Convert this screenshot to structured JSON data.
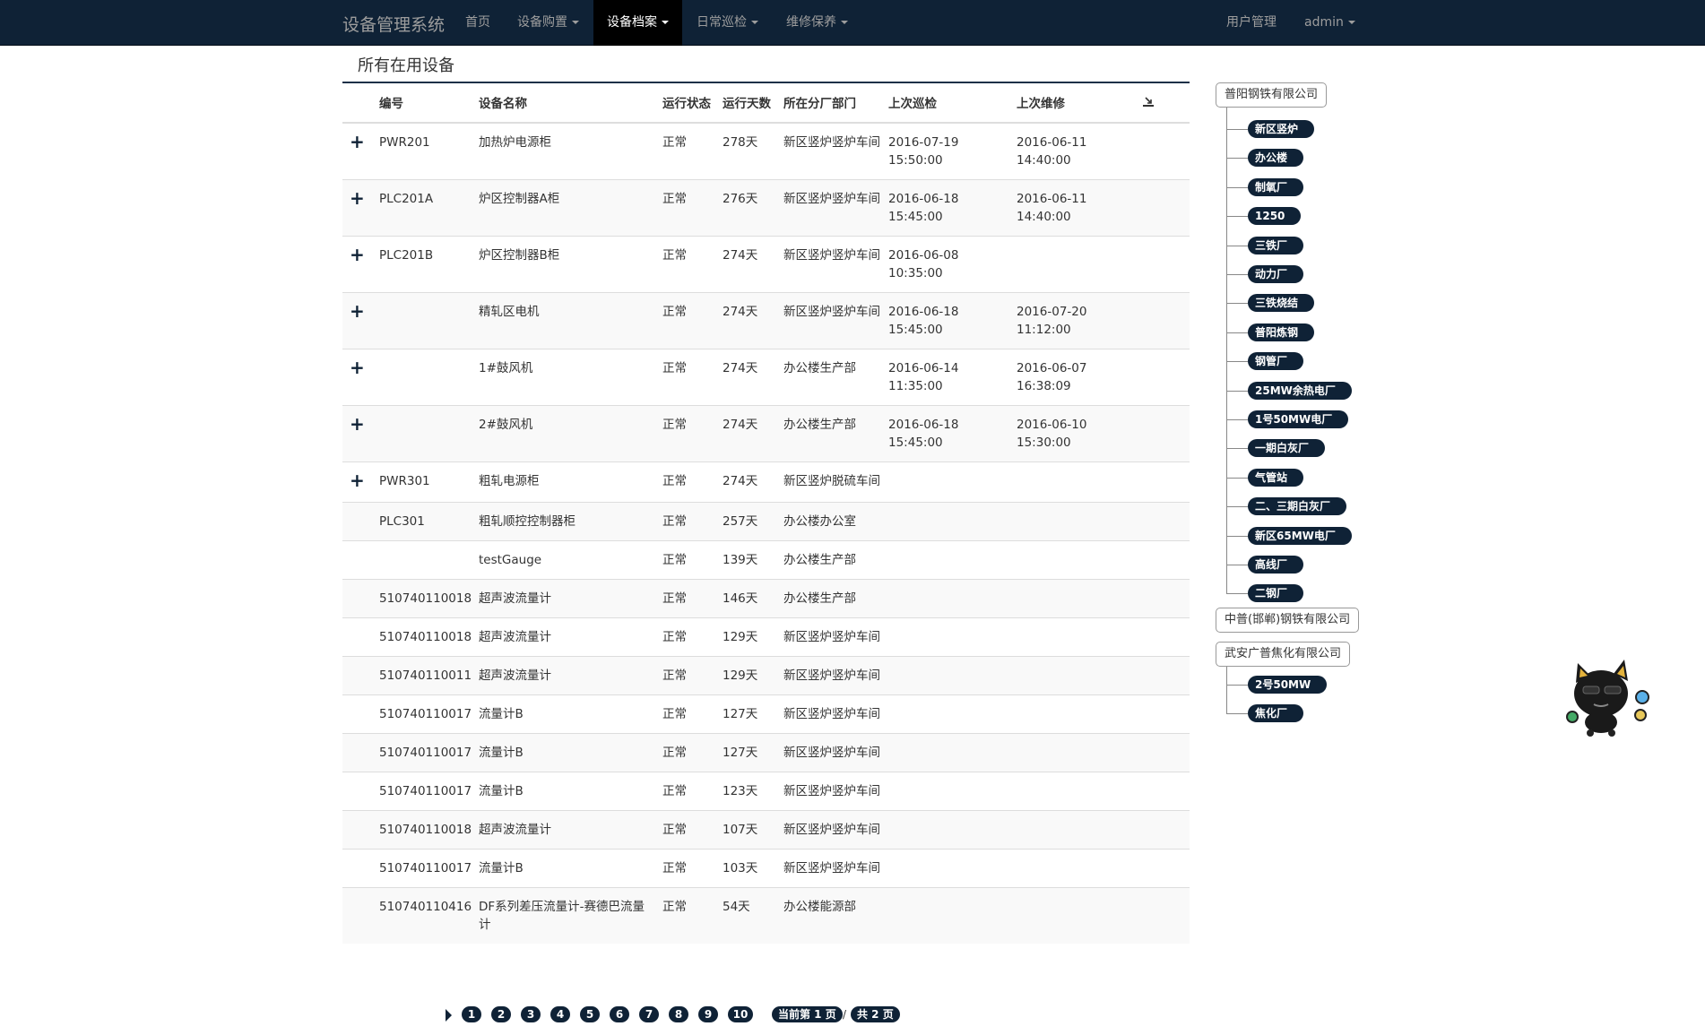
{
  "nav": {
    "brand": "设备管理系统",
    "home": "首页",
    "purchase": "设备购置",
    "archive": "设备档案",
    "inspection": "日常巡检",
    "maintenance": "维修保养",
    "user_admin": "用户管理",
    "account": "admin"
  },
  "page": {
    "title": "所有在用设备"
  },
  "table": {
    "headers": {
      "id": "编号",
      "name": "设备名称",
      "status": "运行状态",
      "days": "运行天数",
      "dept": "所在分厂部门",
      "inspect": "上次巡检",
      "repair": "上次维修"
    },
    "export_icon": "export-icon",
    "rows": [
      {
        "expand": "+",
        "id": "PWR201",
        "name": "加热炉电源柜",
        "status": "正常",
        "days": "278天",
        "dept": "新区竖炉竖炉车间",
        "inspect": "2016-07-19 15:50:00",
        "repair": "2016-06-11 14:40:00"
      },
      {
        "expand": "+",
        "id": "PLC201A",
        "name": "炉区控制器A柜",
        "status": "正常",
        "days": "276天",
        "dept": "新区竖炉竖炉车间",
        "inspect": "2016-06-18 15:45:00",
        "repair": "2016-06-11 14:40:00"
      },
      {
        "expand": "+",
        "id": "PLC201B",
        "name": "炉区控制器B柜",
        "status": "正常",
        "days": "274天",
        "dept": "新区竖炉竖炉车间",
        "inspect": "2016-06-08 10:35:00",
        "repair": ""
      },
      {
        "expand": "+",
        "id": "",
        "name": "精轧区电机",
        "status": "正常",
        "days": "274天",
        "dept": "新区竖炉竖炉车间",
        "inspect": "2016-06-18 15:45:00",
        "repair": "2016-07-20 11:12:00"
      },
      {
        "expand": "+",
        "id": "",
        "name": "1#鼓风机",
        "status": "正常",
        "days": "274天",
        "dept": "办公楼生产部",
        "inspect": "2016-06-14 11:35:00",
        "repair": "2016-06-07 16:38:09"
      },
      {
        "expand": "+",
        "id": "",
        "name": "2#鼓风机",
        "status": "正常",
        "days": "274天",
        "dept": "办公楼生产部",
        "inspect": "2016-06-18 15:45:00",
        "repair": "2016-06-10 15:30:00"
      },
      {
        "expand": "+",
        "id": "PWR301",
        "name": "粗轧电源柜",
        "status": "正常",
        "days": "274天",
        "dept": "新区竖炉脱硫车间",
        "inspect": "",
        "repair": ""
      },
      {
        "expand": "",
        "id": "PLC301",
        "name": "粗轧顺控控制器柜",
        "status": "正常",
        "days": "257天",
        "dept": "办公楼办公室",
        "inspect": "",
        "repair": ""
      },
      {
        "expand": "",
        "id": "",
        "name": "testGauge",
        "status": "正常",
        "days": "139天",
        "dept": "办公楼生产部",
        "inspect": "",
        "repair": ""
      },
      {
        "expand": "",
        "id": "510740110018",
        "name": "超声波流量计",
        "status": "正常",
        "days": "146天",
        "dept": "办公楼生产部",
        "inspect": "",
        "repair": ""
      },
      {
        "expand": "",
        "id": "510740110018",
        "name": "超声波流量计",
        "status": "正常",
        "days": "129天",
        "dept": "新区竖炉竖炉车间",
        "inspect": "",
        "repair": ""
      },
      {
        "expand": "",
        "id": "510740110011",
        "name": "超声波流量计",
        "status": "正常",
        "days": "129天",
        "dept": "新区竖炉竖炉车间",
        "inspect": "",
        "repair": ""
      },
      {
        "expand": "",
        "id": "510740110017",
        "name": "流量计B",
        "status": "正常",
        "days": "127天",
        "dept": "新区竖炉竖炉车间",
        "inspect": "",
        "repair": ""
      },
      {
        "expand": "",
        "id": "510740110017",
        "name": "流量计B",
        "status": "正常",
        "days": "127天",
        "dept": "新区竖炉竖炉车间",
        "inspect": "",
        "repair": ""
      },
      {
        "expand": "",
        "id": "510740110017",
        "name": "流量计B",
        "status": "正常",
        "days": "123天",
        "dept": "新区竖炉竖炉车间",
        "inspect": "",
        "repair": ""
      },
      {
        "expand": "",
        "id": "510740110018",
        "name": "超声波流量计",
        "status": "正常",
        "days": "107天",
        "dept": "新区竖炉竖炉车间",
        "inspect": "",
        "repair": ""
      },
      {
        "expand": "",
        "id": "510740110017",
        "name": "流量计B",
        "status": "正常",
        "days": "103天",
        "dept": "新区竖炉竖炉车间",
        "inspect": "",
        "repair": ""
      },
      {
        "expand": "",
        "id": "510740110416",
        "name": "DF系列差压流量计-赛德巴流量计",
        "status": "正常",
        "days": "54天",
        "dept": "办公楼能源部",
        "inspect": "",
        "repair": ""
      }
    ]
  },
  "pagination": {
    "pages": [
      "1",
      "2",
      "3",
      "4",
      "5",
      "6",
      "7",
      "8",
      "9",
      "10"
    ],
    "current": "当前第 1 页",
    "separator": "/",
    "total": "共 2 页"
  },
  "tree": {
    "companies": [
      {
        "name": "普阳钢铁有限公司",
        "children": [
          "新区竖炉",
          "办公楼",
          "制氧厂",
          "1250",
          "三铁厂",
          "动力厂",
          "三铁烧结",
          "普阳炼钢",
          "钢管厂",
          "25MW余热电厂",
          "1号50MW电厂",
          "一期白灰厂",
          "气管站",
          "二、三期白灰厂",
          "新区65MW电厂",
          "高线厂",
          "二钢厂"
        ]
      },
      {
        "name": "中普(邯郸)钢铁有限公司",
        "children": []
      },
      {
        "name": "武安广普焦化有限公司",
        "children": [
          "2号50MW",
          "焦化厂"
        ]
      }
    ]
  },
  "colors": {
    "navbar": "#0f2236",
    "accent": "#0f2236",
    "row_stripe": "#f9f9f9"
  }
}
